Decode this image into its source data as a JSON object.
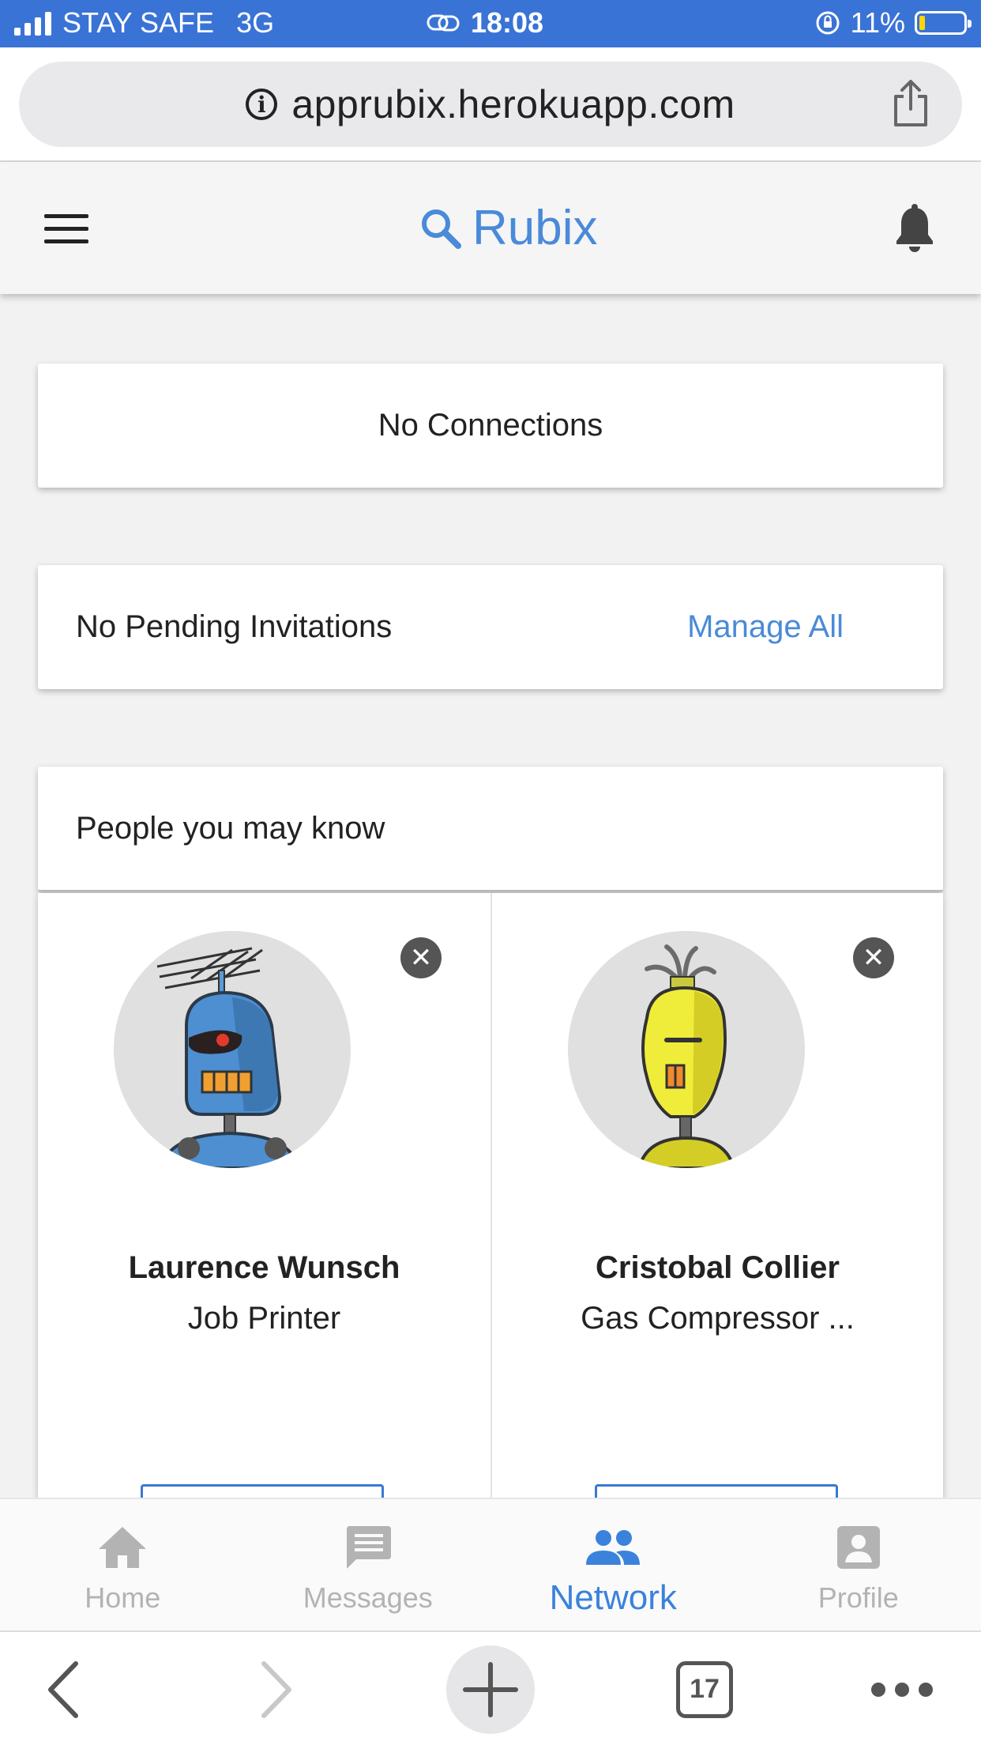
{
  "status_bar": {
    "carrier": "STAY SAFE",
    "network": "3G",
    "time": "18:08",
    "battery": "11%"
  },
  "browser": {
    "url": "apprubix.herokuapp.com",
    "tab_count": "17"
  },
  "header": {
    "brand": "Rubix"
  },
  "connections": {
    "text": "No Connections"
  },
  "invitations": {
    "text": "No Pending Invitations",
    "manage_label": "Manage All"
  },
  "people": {
    "heading": "People you may know",
    "items": [
      {
        "name": "Laurence Wunsch",
        "title": "Job Printer"
      },
      {
        "name": "Cristobal Collier",
        "title": "Gas Compressor ..."
      }
    ]
  },
  "nav": {
    "items": [
      {
        "label": "Home",
        "icon": "home-icon"
      },
      {
        "label": "Messages",
        "icon": "message-icon"
      },
      {
        "label": "Network",
        "icon": "people-icon",
        "active": true
      },
      {
        "label": "Profile",
        "icon": "account-box-icon"
      }
    ]
  },
  "colors": {
    "accent": "#4a8ad9",
    "status_bar": "#3a73d6",
    "battery_low": "#ffd60a"
  }
}
